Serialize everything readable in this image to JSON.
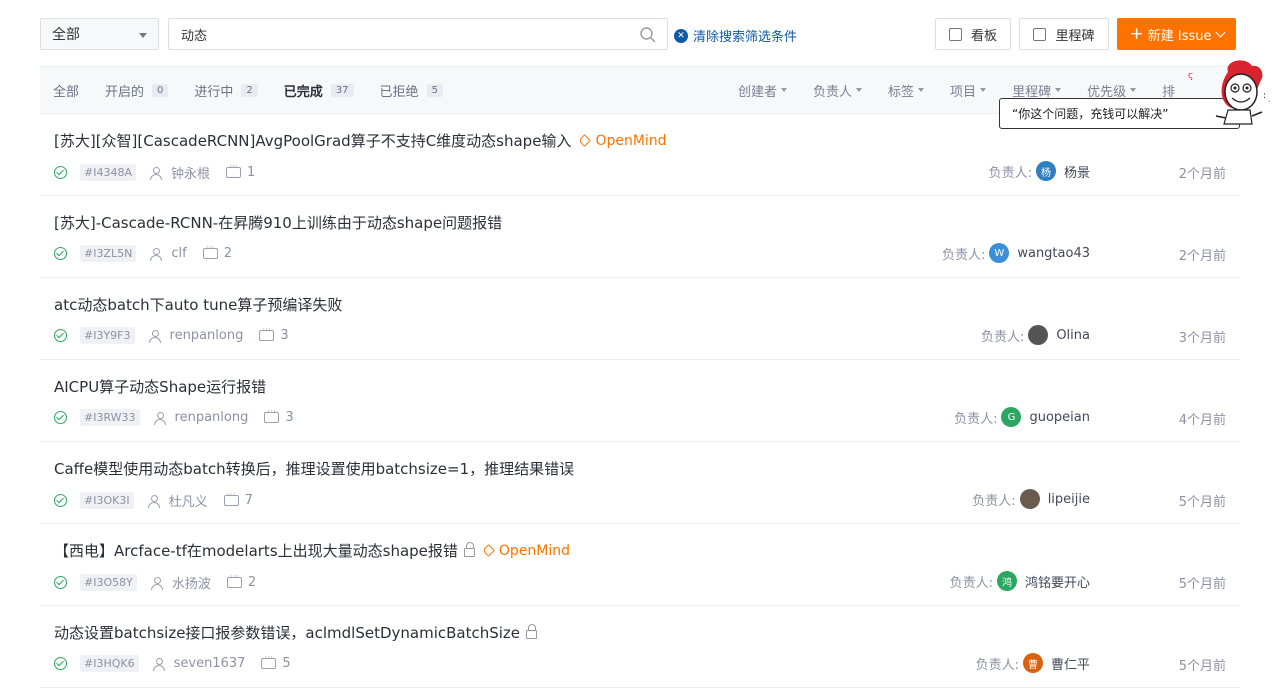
{
  "toolbar": {
    "scope": "全部",
    "search_value": "动态",
    "clear_filter": "清除搜索筛选条件",
    "board_label": "看板",
    "milestone_label": "里程碑",
    "new_issue_label": "新建 Issue"
  },
  "tabs": [
    {
      "label": "全部",
      "count": ""
    },
    {
      "label": "开启的",
      "count": "0"
    },
    {
      "label": "进行中",
      "count": "2"
    },
    {
      "label": "已完成",
      "count": "37"
    },
    {
      "label": "已拒绝",
      "count": "5"
    }
  ],
  "filters": [
    "创建者",
    "负责人",
    "标签",
    "项目",
    "里程碑",
    "优先级",
    "排"
  ],
  "popup": {
    "text": "“你这个问题，充钱可以解决”"
  },
  "issues": [
    {
      "title": "[苏大][众智][CascadeRCNN]AvgPoolGrad算子不支持C维度动态shape输入",
      "tag": "OpenMind",
      "ident": "#I4348A",
      "author": "钟永根",
      "comments": "1",
      "assignee_label": "负责人:",
      "assignee": "杨景",
      "avatar": "杨",
      "avatar_color": "#2f7fc1",
      "time": "2个月前"
    },
    {
      "title": "[苏大]-Cascade-RCNN-在昇腾910上训练由于动态shape问题报错",
      "tag": "",
      "ident": "#I3ZL5N",
      "author": "clf",
      "comments": "2",
      "assignee_label": "负责人:",
      "assignee": "wangtao43",
      "avatar": "W",
      "avatar_color": "#3b8fd6",
      "time": "2个月前"
    },
    {
      "title": "atc动态batch下auto tune算子预编译失败",
      "tag": "",
      "ident": "#I3Y9F3",
      "author": "renpanlong",
      "comments": "3",
      "assignee_label": "负责人:",
      "assignee": "Olina",
      "avatar": "",
      "avatar_color": "#555555",
      "time": "3个月前"
    },
    {
      "title": "AICPU算子动态Shape运行报错",
      "tag": "",
      "ident": "#I3RW33",
      "author": "renpanlong",
      "comments": "3",
      "assignee_label": "负责人:",
      "assignee": "guopeian",
      "avatar": "G",
      "avatar_color": "#2aa760",
      "time": "4个月前"
    },
    {
      "title": "Caffe模型使用动态batch转换后，推理设置使用batchsize=1，推理结果错误",
      "tag": "",
      "ident": "#I3OK3I",
      "author": "杜凡义",
      "comments": "7",
      "assignee_label": "负责人:",
      "assignee": "lipeijie",
      "avatar": "",
      "avatar_color": "#6b5a4e",
      "time": "5个月前"
    },
    {
      "title": "【西电】Arcface-tf在modelarts上出现大量动态shape报错",
      "tag": "OpenMind",
      "ident": "#I3O58Y",
      "author": "水扬波",
      "comments": "2",
      "assignee_label": "负责人:",
      "assignee": "鸿铭要开心",
      "avatar": "鸿",
      "avatar_color": "#2aa760",
      "time": "5个月前"
    },
    {
      "title": "动态设置batchsize接口报参数错误，aclmdlSetDynamicBatchSize",
      "tag": "",
      "ident": "#I3HQK6",
      "author": "seven1637",
      "comments": "5",
      "assignee_label": "负责人:",
      "assignee": "曹仁平",
      "avatar": "曹",
      "avatar_color": "#d9620f",
      "time": "5个月前"
    }
  ],
  "colors": {
    "accent": "#fe7300",
    "link": "#0e5aa8",
    "success": "#2aa760"
  }
}
